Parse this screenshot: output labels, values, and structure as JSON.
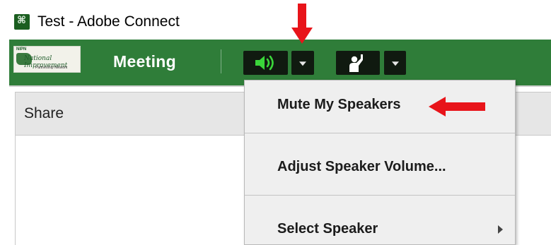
{
  "window": {
    "title": "Test - Adobe Connect",
    "icon": "adobe-connect-icon"
  },
  "menubar": {
    "logo_text": "NIPN",
    "logo_wordmark": "National Improvement",
    "logo_subtitle": "Partnership Network",
    "meeting_label": "Meeting",
    "speaker_icon": "speaker-icon",
    "raise_hand_icon": "raise-hand-icon",
    "background_color": "#2f7d39",
    "speaker_active_color": "#3ad63a"
  },
  "pod": {
    "title": "Share"
  },
  "dropdown": {
    "items": [
      {
        "label": "Mute My Speakers",
        "has_submenu": false
      },
      {
        "label": "Adjust Speaker Volume...",
        "has_submenu": false
      },
      {
        "label": "Select Speaker",
        "has_submenu": true
      }
    ]
  },
  "annotations": {
    "arrow_color": "#e8141a"
  }
}
